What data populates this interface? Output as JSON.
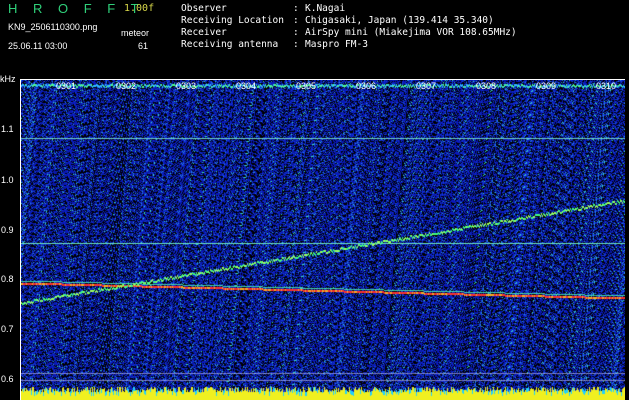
{
  "header": {
    "logo": "H R O F F T",
    "version": "1.00f",
    "filename": "KN9_2506110300.png",
    "datetime": "25.06.11 03:00",
    "meteor_label": "meteor",
    "meteor_count": "61"
  },
  "info": [
    {
      "label": "Observer",
      "value": "K.Nagai"
    },
    {
      "label": "Receiving Location",
      "value": "Chigasaki, Japan (139.414 35.340)"
    },
    {
      "label": "Receiver",
      "value": "AirSpy mini (Miakejima VOR 108.65MHz)"
    },
    {
      "label": "Receiving antenna",
      "value": "Maspro FM-3"
    }
  ],
  "axis": {
    "unit": "kHz",
    "yticks": [
      "1.1",
      "1.0",
      "0.9",
      "0.8",
      "0.7",
      "0.6"
    ],
    "time_labels": [
      "0301",
      "0302",
      "0303",
      "0304",
      "0305",
      "0306",
      "0307",
      "0308",
      "0309",
      "0310"
    ]
  },
  "colors": {
    "background": "#000000",
    "noise": "#0a1aa0",
    "signal": "#30ff90",
    "carrier": "#ff3030",
    "meter": "#ffff20"
  }
}
